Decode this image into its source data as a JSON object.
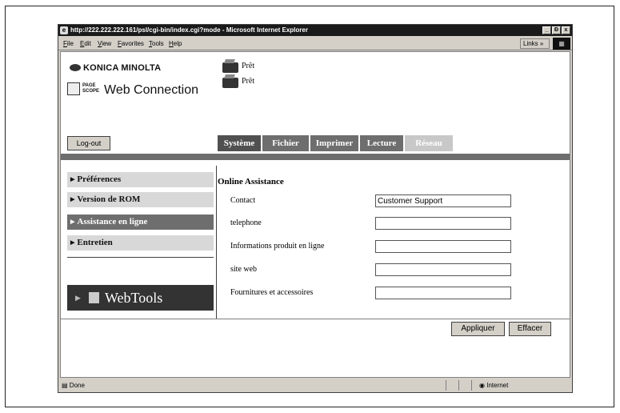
{
  "window": {
    "title": "http://222.222.222.161/psl/cgi-bin/index.cgi?mode - Microsoft Internet Explorer",
    "minimize": "_",
    "maximize": "Ɖ",
    "close": "x"
  },
  "menubar": {
    "items": [
      "File",
      "Edit",
      "View",
      "Favorites",
      "Tools",
      "Help"
    ],
    "links_label": "Links »"
  },
  "branding": {
    "konica": "KONICA MINOLTA",
    "pagescope_badge": "PAGE SCOPE",
    "web_connection": "Web Connection"
  },
  "printer_status": [
    "Prêt",
    "Prêt"
  ],
  "logout": "Log-out",
  "tabs": [
    {
      "label": "Système",
      "color": "#505050"
    },
    {
      "label": "Fichier",
      "color": "#6e6e6e"
    },
    {
      "label": "Imprimer",
      "color": "#6e6e6e"
    },
    {
      "label": "Lecture",
      "color": "#6e6e6e"
    },
    {
      "label": "Réseau",
      "color": "#c8c8c8"
    }
  ],
  "sidebar": {
    "items": [
      {
        "label": "Préférences",
        "active": false
      },
      {
        "label": "Version de ROM",
        "active": false
      },
      {
        "label": "Assistance en ligne",
        "active": true
      },
      {
        "label": "Entretien",
        "active": false
      }
    ],
    "webtools": "WebTools"
  },
  "form": {
    "title": "Online Assistance",
    "fields": [
      {
        "label": "Contact",
        "value": "Customer Support"
      },
      {
        "label": "telephone",
        "value": ""
      },
      {
        "label": "Informations produit en ligne",
        "value": ""
      },
      {
        "label": "site web",
        "value": ""
      },
      {
        "label": "Fournitures et accessoires",
        "value": ""
      }
    ],
    "apply": "Appliquer",
    "clear": "Effacer"
  },
  "statusbar": {
    "done": "Done",
    "zone": "Internet"
  },
  "colors": {
    "active_side": "#6e6e6e",
    "inactive_side": "#d8d8d8",
    "bar": "#6e6e6e"
  }
}
